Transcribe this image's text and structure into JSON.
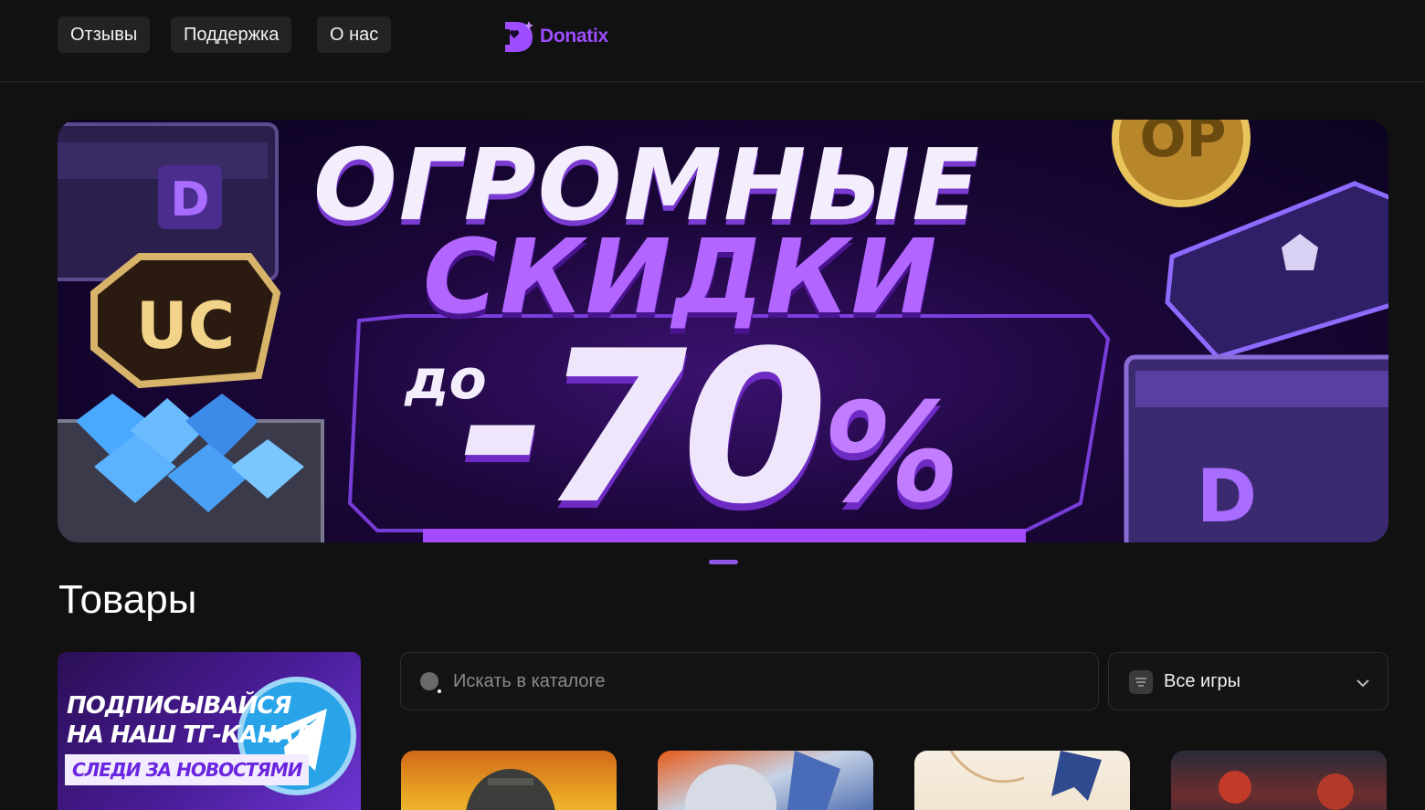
{
  "header": {
    "nav": [
      {
        "label": "Отзывы"
      },
      {
        "label": "Поддержка"
      },
      {
        "label": "О нас"
      }
    ],
    "logo_text": "Donatix"
  },
  "banner": {
    "line1": "ОГРОМНЫЕ",
    "line2": "СКИДКИ",
    "prefix": "до",
    "discount": "-70",
    "percent": "%",
    "badge_uc": "UC"
  },
  "carousel": {
    "active_index": 0,
    "count": 1
  },
  "products": {
    "title": "Товары",
    "promo": {
      "line1": "ПОДПИСЫВАЙСЯ",
      "line2": "НА НАШ ТГ-КАНАЛ",
      "tag": "СЛЕДИ ЗА НОВОСТЯМИ"
    },
    "search": {
      "placeholder": "Искать в каталоге",
      "value": ""
    },
    "filter": {
      "selected": "Все игры"
    },
    "game_cards_icons": [
      "pubg-helmet-image",
      "anime-hero-image",
      "anime-character-image",
      "spiderman-image"
    ]
  },
  "colors": {
    "background": "#111111",
    "accent": "#9d4dff",
    "banner_bg": "#1a0638"
  }
}
